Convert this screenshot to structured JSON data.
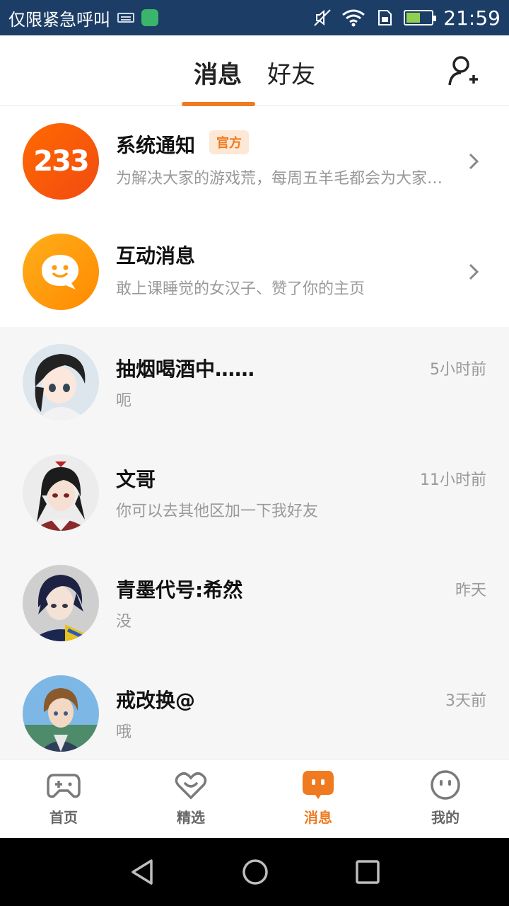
{
  "status_bar": {
    "carrier": "仅限紧急呼叫",
    "time": "21:59",
    "battery_level": 0.55
  },
  "top_tabs": {
    "messages": "消息",
    "friends": "好友",
    "active": "消息"
  },
  "notices": [
    {
      "title": "系统通知",
      "tag": "官方",
      "subtitle": "为解决大家的游戏荒，每周五羊毛都会为大家推荐",
      "icon": "233-logo",
      "icon_text": "233"
    },
    {
      "title": "互动消息",
      "subtitle": "敢上课睡觉的女汉子、赞了你的主页",
      "icon": "chat-bubble-icon"
    }
  ],
  "conversations": [
    {
      "name": "抽烟喝酒中……",
      "time": "5小时前",
      "message": "呃"
    },
    {
      "name": "文哥",
      "time": "11小时前",
      "message": "你可以去其他区加一下我好友"
    },
    {
      "name": "青墨代号:希然",
      "time": "昨天",
      "message": "没"
    },
    {
      "name": "戒改换@",
      "time": "3天前",
      "message": "哦"
    }
  ],
  "bottom_nav": [
    {
      "label": "首页",
      "icon": "gamepad-icon"
    },
    {
      "label": "精选",
      "icon": "heart-smile-icon"
    },
    {
      "label": "消息",
      "icon": "message-icon",
      "active": true
    },
    {
      "label": "我的",
      "icon": "profile-face-icon"
    }
  ],
  "colors": {
    "accent": "#f07a1f",
    "status_bar": "#1c3d66",
    "list_background": "#f6f6f6"
  }
}
